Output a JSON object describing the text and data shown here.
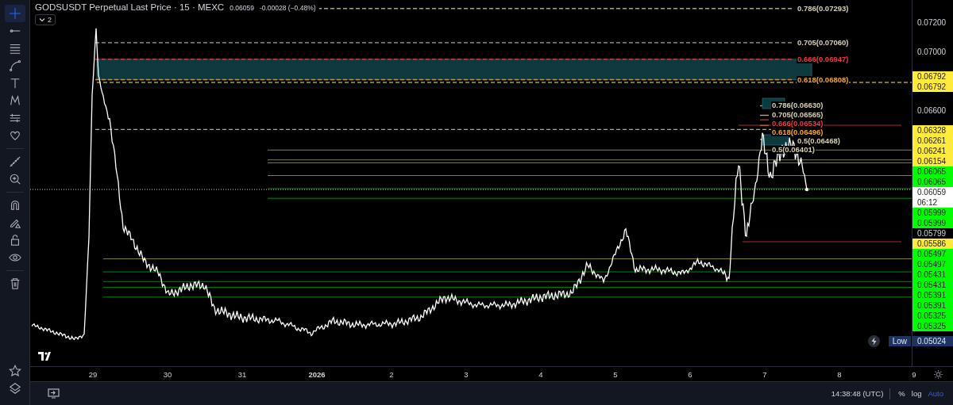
{
  "header": {
    "title": "GODSUSDT Perpetual Last Price · 15 · MEXC",
    "price": "0.06059",
    "change": "-0.00028 (−0.48%)",
    "indicators_count": "2",
    "indicators_expanded": false
  },
  "toolbar": {
    "tools": [
      {
        "kind": "crosshair",
        "selected": true
      },
      {
        "kind": "line",
        "selected": false
      },
      {
        "kind": "fib",
        "selected": false
      },
      {
        "kind": "curve",
        "selected": false
      },
      {
        "kind": "text",
        "selected": false
      },
      {
        "kind": "pattern",
        "selected": false
      },
      {
        "kind": "measure",
        "selected": false
      },
      {
        "kind": "heart",
        "selected": false
      },
      {
        "kind": "ruler",
        "selected": false
      },
      {
        "kind": "zoom",
        "selected": false
      },
      {
        "kind": "magnet",
        "selected": false
      },
      {
        "kind": "pencil",
        "selected": false
      },
      {
        "kind": "lock",
        "selected": false
      },
      {
        "kind": "eye",
        "selected": false
      },
      {
        "kind": "trash",
        "selected": false
      }
    ],
    "bottom_tools": [
      {
        "kind": "star",
        "selected": false
      },
      {
        "kind": "layers",
        "selected": false
      }
    ]
  },
  "fibs": [
    {
      "levels": [
        {
          "text": "0.786(0.07293)",
          "color": "#d6cfb4"
        },
        {
          "text": "0.705(0.07060)",
          "color": "#d6cfb4"
        },
        {
          "text": "0.666(0.06947)",
          "color": "#f23645"
        },
        {
          "text": "0.618(0.06808)",
          "color": "#f5a623"
        },
        {
          "text": "0.5(0.06468)",
          "color": "#d6cfb4"
        }
      ]
    },
    {
      "levels": [
        {
          "text": "0.786(0.06630)",
          "color": "#d6cfb4"
        },
        {
          "text": "0.705(0.06565)",
          "color": "#d6cfb4"
        },
        {
          "text": "0.666(0.06534)",
          "color": "#f23645"
        },
        {
          "text": "0.618(0.06496)",
          "color": "#f5a623"
        },
        {
          "text": "0.5(0.06401)",
          "color": "#d6cfb4"
        }
      ]
    }
  ],
  "axis_labels": [
    {
      "text": "0.07200",
      "kind": "tick"
    },
    {
      "text": "0.07000",
      "kind": "tick"
    },
    {
      "text": "0.06792",
      "kind": "marker",
      "color": "#ffeb3b"
    },
    {
      "text": "0.06792",
      "kind": "marker",
      "color": "#ffeb3b"
    },
    {
      "text": "0.06600",
      "kind": "tick"
    },
    {
      "text": "0.06328",
      "kind": "marker",
      "color": "#ffeb3b"
    },
    {
      "text": "0.06261",
      "kind": "marker",
      "color": "#ffeb3b"
    },
    {
      "text": "0.06241",
      "kind": "marker",
      "color": "#ffeb3b"
    },
    {
      "text": "0.06154",
      "kind": "marker",
      "color": "#ffeb3b"
    },
    {
      "text": "0.06065",
      "kind": "marker",
      "color": "#00ff00"
    },
    {
      "text": "0.06065",
      "kind": "marker",
      "color": "#00ff00"
    },
    {
      "text": "0.06059",
      "kind": "current",
      "color": "#ffffff",
      "countdown": "06:12"
    },
    {
      "text": "0.05999",
      "kind": "marker",
      "color": "#00ff00"
    },
    {
      "text": "0.05999",
      "kind": "marker",
      "color": "#00ff00"
    },
    {
      "text": "0.05799",
      "kind": "tick"
    },
    {
      "text": "0.05586",
      "kind": "marker",
      "color": "#ffeb3b"
    },
    {
      "text": "0.05497",
      "kind": "marker",
      "color": "#00ff00"
    },
    {
      "text": "0.05497",
      "kind": "marker",
      "color": "#00ff00"
    },
    {
      "text": "0.05431",
      "kind": "marker",
      "color": "#00ff00"
    },
    {
      "text": "0.05431",
      "kind": "marker",
      "color": "#00ff00"
    },
    {
      "text": "0.05391",
      "kind": "marker",
      "color": "#00ff00"
    },
    {
      "text": "0.05391",
      "kind": "marker",
      "color": "#00ff00"
    },
    {
      "text": "0.05325",
      "kind": "marker",
      "color": "#00ff00"
    },
    {
      "text": "0.05325",
      "kind": "marker",
      "color": "#00ff00"
    },
    {
      "text": "0.05024",
      "kind": "low",
      "color": "#1d3461",
      "tag": "Low"
    }
  ],
  "time_axis": [
    {
      "text": "29",
      "kind": "day"
    },
    {
      "text": "30",
      "kind": "day"
    },
    {
      "text": "31",
      "kind": "day"
    },
    {
      "text": "2026",
      "kind": "year"
    },
    {
      "text": "2",
      "kind": "day"
    },
    {
      "text": "3",
      "kind": "day"
    },
    {
      "text": "4",
      "kind": "day"
    },
    {
      "text": "5",
      "kind": "day"
    },
    {
      "text": "6",
      "kind": "day"
    },
    {
      "text": "7",
      "kind": "day"
    },
    {
      "text": "8",
      "kind": "day"
    },
    {
      "text": "9",
      "kind": "day"
    }
  ],
  "bottom_bar": {
    "time": "14:38:48 (UTC)",
    "scale_options": [
      {
        "label": "%",
        "selected": false
      },
      {
        "label": "log",
        "selected": false
      },
      {
        "label": "Auto",
        "selected": true
      }
    ]
  }
}
